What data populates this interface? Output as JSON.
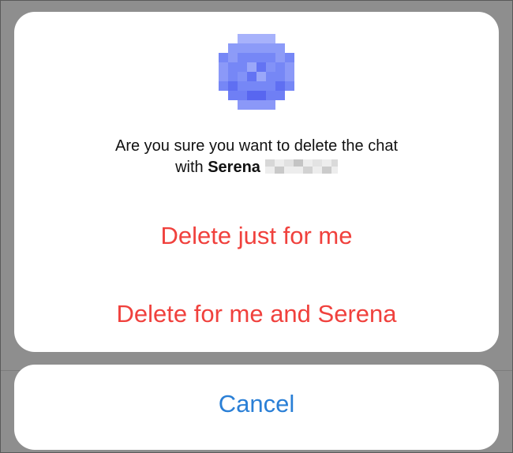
{
  "dialog": {
    "message_prefix": "Are you sure you want to delete the chat",
    "message_with": "with",
    "contact_first_name": "Serena",
    "avatar_icon": "pixelated-contact-avatar-icon",
    "contact_surname_icon": "pixelated-surname-redaction"
  },
  "actions": {
    "delete_for_me": "Delete just for me",
    "delete_for_both": "Delete for me and Serena"
  },
  "cancel": {
    "label": "Cancel"
  },
  "colors": {
    "destructive": "#f0413d",
    "cancel": "#2a7fd6",
    "avatar": "#6f80f8",
    "backdrop": "#8e8e8e"
  }
}
